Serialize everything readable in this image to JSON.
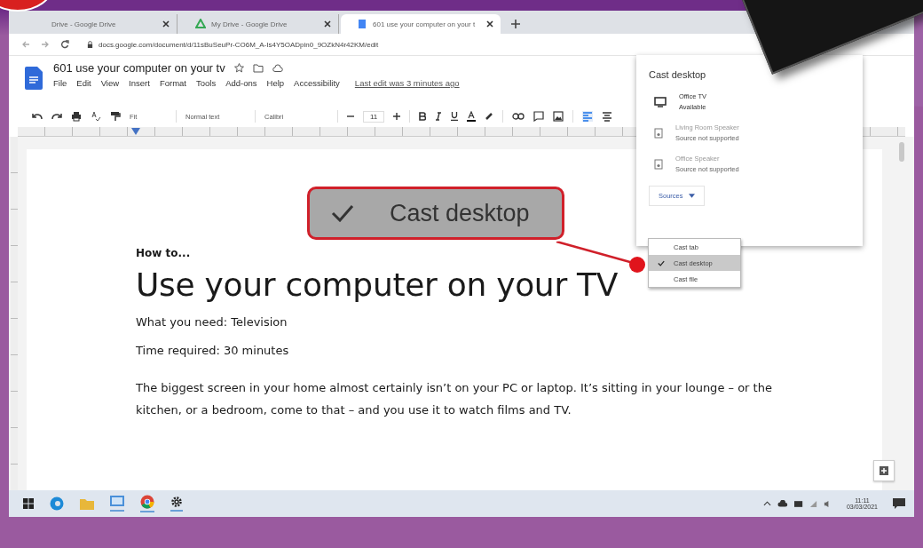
{
  "browser": {
    "tabs": [
      {
        "title": "Drive - Google Drive",
        "selected": false
      },
      {
        "title": "My Drive - Google Drive",
        "selected": false
      },
      {
        "title": "601 use your computer on your t",
        "selected": true
      }
    ],
    "address": "docs.google.com/document/d/11sBuSeuPr-CO6M_A-Is4Y5OADpin0_9OZkN4r42KM/edit"
  },
  "doc_header": {
    "title": "601 use your computer on your tv",
    "menu": [
      "File",
      "Edit",
      "View",
      "Insert",
      "Format",
      "Tools",
      "Add-ons",
      "Help",
      "Accessibility"
    ],
    "last_edit": "Last edit was 3 minutes ago"
  },
  "toolbar": {
    "zoom": "Fit",
    "style": "Normal text",
    "font": "Calibri",
    "size": "11"
  },
  "document": {
    "kicker": "How to...",
    "heading": "Use your computer on your TV",
    "lines": [
      "What you need: Television",
      "Time required: 30 minutes"
    ],
    "paragraph": "The biggest screen in your home almost certainly isn’t on your PC or laptop. It’s sitting in your lounge – or the kitchen, or a bedroom, come to that – and you use it to watch films and TV."
  },
  "cast_panel": {
    "title": "Cast desktop",
    "devices": [
      {
        "name": "Office TV",
        "status": "Available",
        "kind": "tv",
        "disabled": false
      },
      {
        "name": "Living Room Speaker",
        "status": "Source not supported",
        "kind": "speaker",
        "disabled": true
      },
      {
        "name": "Office Speaker",
        "status": "Source not supported",
        "kind": "speaker",
        "disabled": true
      }
    ],
    "sources_button": "Sources",
    "sources": [
      {
        "label": "Cast tab",
        "selected": false
      },
      {
        "label": "Cast desktop",
        "selected": true
      },
      {
        "label": "Cast file",
        "selected": false
      }
    ]
  },
  "callout": {
    "label": "Cast desktop"
  },
  "taskbar": {
    "time": "11:11",
    "date": "03/03/2021"
  }
}
